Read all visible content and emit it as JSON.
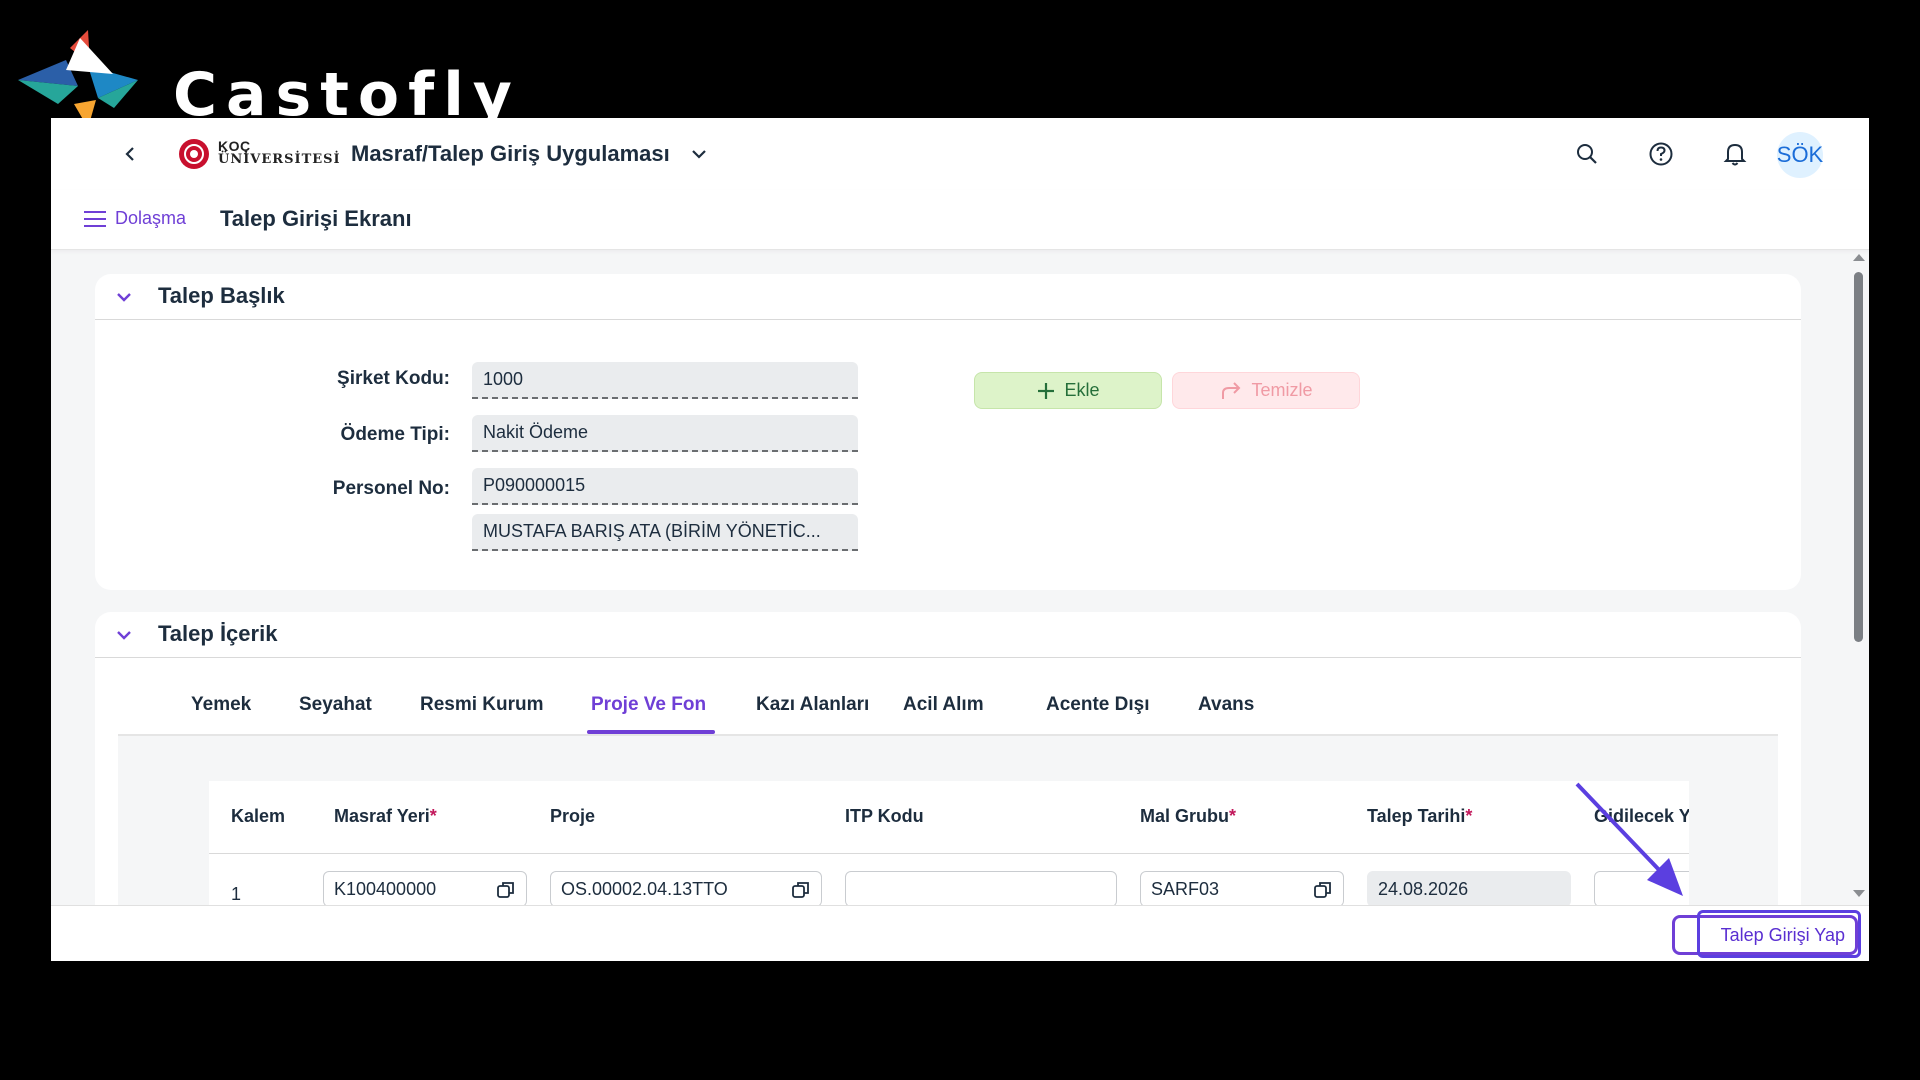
{
  "branding": {
    "name": "Castofly"
  },
  "shellbar": {
    "logo_line1": "KOÇ",
    "logo_line2": "ÜNİVERSİTESİ",
    "app_title": "Masraf/Talep Giriş Uygulaması",
    "avatar_initials": "SÖK"
  },
  "subheader": {
    "nav_label": "Dolaşma",
    "page_title": "Talep Girişi Ekranı"
  },
  "header_panel": {
    "title": "Talep Başlık",
    "fields": [
      {
        "label": "Şirket Kodu:",
        "value": "1000"
      },
      {
        "label": "Ödeme Tipi:",
        "value": "Nakit Ödeme"
      },
      {
        "label": "Personel No:",
        "value": "P090000015"
      }
    ],
    "personnel_name": "MUSTAFA BARIŞ  ATA (BİRİM YÖNETİC...",
    "add_label": "Ekle",
    "clear_label": "Temizle"
  },
  "content_panel": {
    "title": "Talep İçerik",
    "tabs": [
      "Yemek",
      "Seyahat",
      "Resmi Kurum",
      "Proje Ve Fon",
      "Kazı Alanları",
      "Acil Alım",
      "Acente Dışı",
      "Avans"
    ],
    "active_tab": "Proje Ve Fon",
    "table": {
      "columns": [
        "Kalem",
        "Masraf Yeri",
        "Proje",
        "ITP Kodu",
        "Mal Grubu",
        "Talep Tarihi",
        "Gidilecek Y"
      ],
      "required_mark": "*",
      "rows": [
        {
          "kalem": "1",
          "masraf_yeri": "K100400000",
          "proje": "OS.00002.04.13TTO",
          "itp_kodu": "",
          "mal_grubu": "SARF03",
          "talep_tarihi": "24.08.2026",
          "gidilecek": ""
        }
      ]
    }
  },
  "footer": {
    "submit_label": "Talep Girişi Yap"
  },
  "colors": {
    "accent": "#6f3fd6",
    "add_bg": "#ddf3c9",
    "clear_bg": "#ffe9eb"
  }
}
